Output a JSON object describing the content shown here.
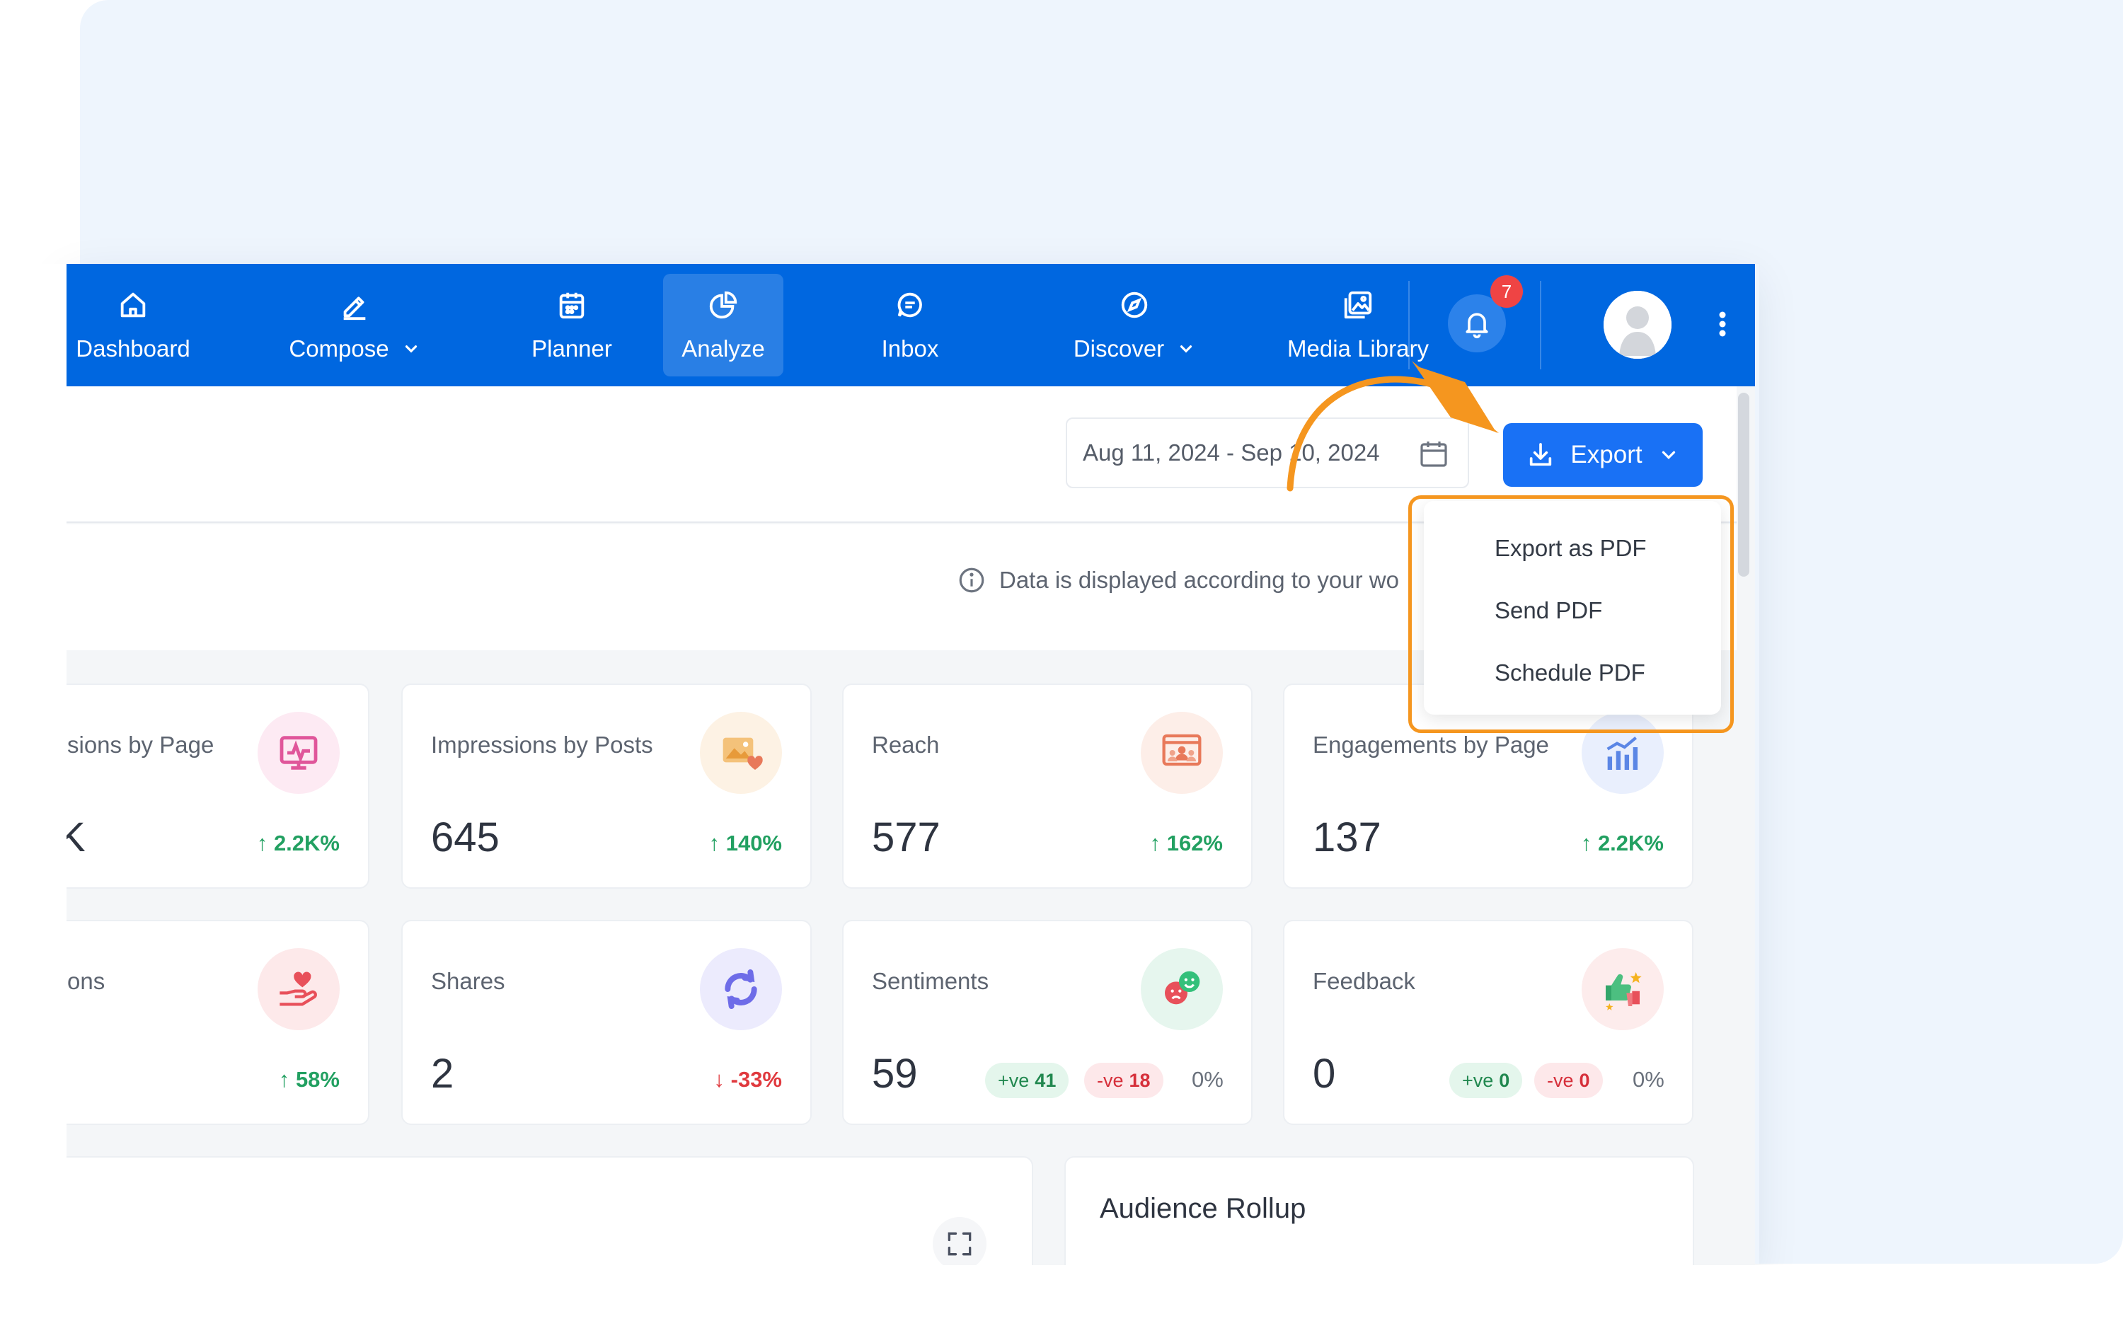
{
  "nav": {
    "items": [
      {
        "label": "Dashboard",
        "icon": "home-icon"
      },
      {
        "label": "Compose",
        "icon": "pencil-icon",
        "dropdown": true
      },
      {
        "label": "Planner",
        "icon": "calendar-icon"
      },
      {
        "label": "Analyze",
        "icon": "pie-chart-icon",
        "active": true
      },
      {
        "label": "Inbox",
        "icon": "chat-icon"
      },
      {
        "label": "Discover",
        "icon": "compass-icon",
        "dropdown": true
      },
      {
        "label": "Media Library",
        "icon": "image-icon"
      }
    ],
    "notification_count": "7",
    "accent_color": "#0067e0"
  },
  "header": {
    "date_range": "Aug 11, 2024 - Sep 10, 2024",
    "export_label": "Export"
  },
  "info": {
    "text": "Data is displayed according to your wo"
  },
  "export_menu": {
    "items": [
      "Export as PDF",
      "Send PDF",
      "Schedule PDF"
    ]
  },
  "cards": {
    "impressions_by_page": {
      "title": "sions by Page",
      "value": "K",
      "change": "↑ 2.2K%"
    },
    "impressions_by_posts": {
      "title": "Impressions by Posts",
      "value": "645",
      "change": "↑ 140%"
    },
    "reach": {
      "title": "Reach",
      "value": "577",
      "change": "↑ 162%"
    },
    "engagements_by_page": {
      "title": "Engagements by Page",
      "value": "137",
      "change": "↑ 2.2K%"
    },
    "reactions": {
      "title": "ons",
      "change": "↑ 58%"
    },
    "shares": {
      "title": "Shares",
      "value": "2",
      "change": "↓ -33%"
    },
    "sentiments": {
      "title": "Sentiments",
      "value": "59",
      "pos_label": "+ve",
      "pos_value": "41",
      "neg_label": "-ve",
      "neg_value": "18",
      "pct": "0%"
    },
    "feedback": {
      "title": "Feedback",
      "value": "0",
      "pos_label": "+ve",
      "pos_value": "0",
      "neg_label": "-ve",
      "neg_value": "0",
      "pct": "0%"
    }
  },
  "bottom": {
    "rollup_title": "Audience Rollup"
  }
}
